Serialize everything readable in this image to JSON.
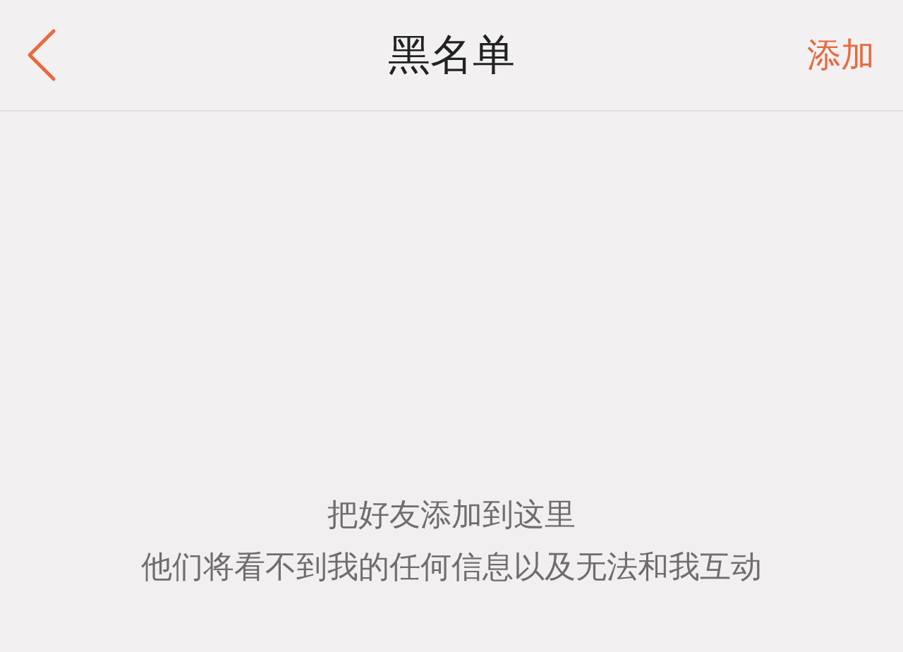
{
  "header": {
    "title": "黑名单",
    "action": "添加"
  },
  "empty_state": {
    "lines": [
      "把好友添加到这里",
      "他们将看不到我的任何信息以及无法和我互动"
    ]
  }
}
